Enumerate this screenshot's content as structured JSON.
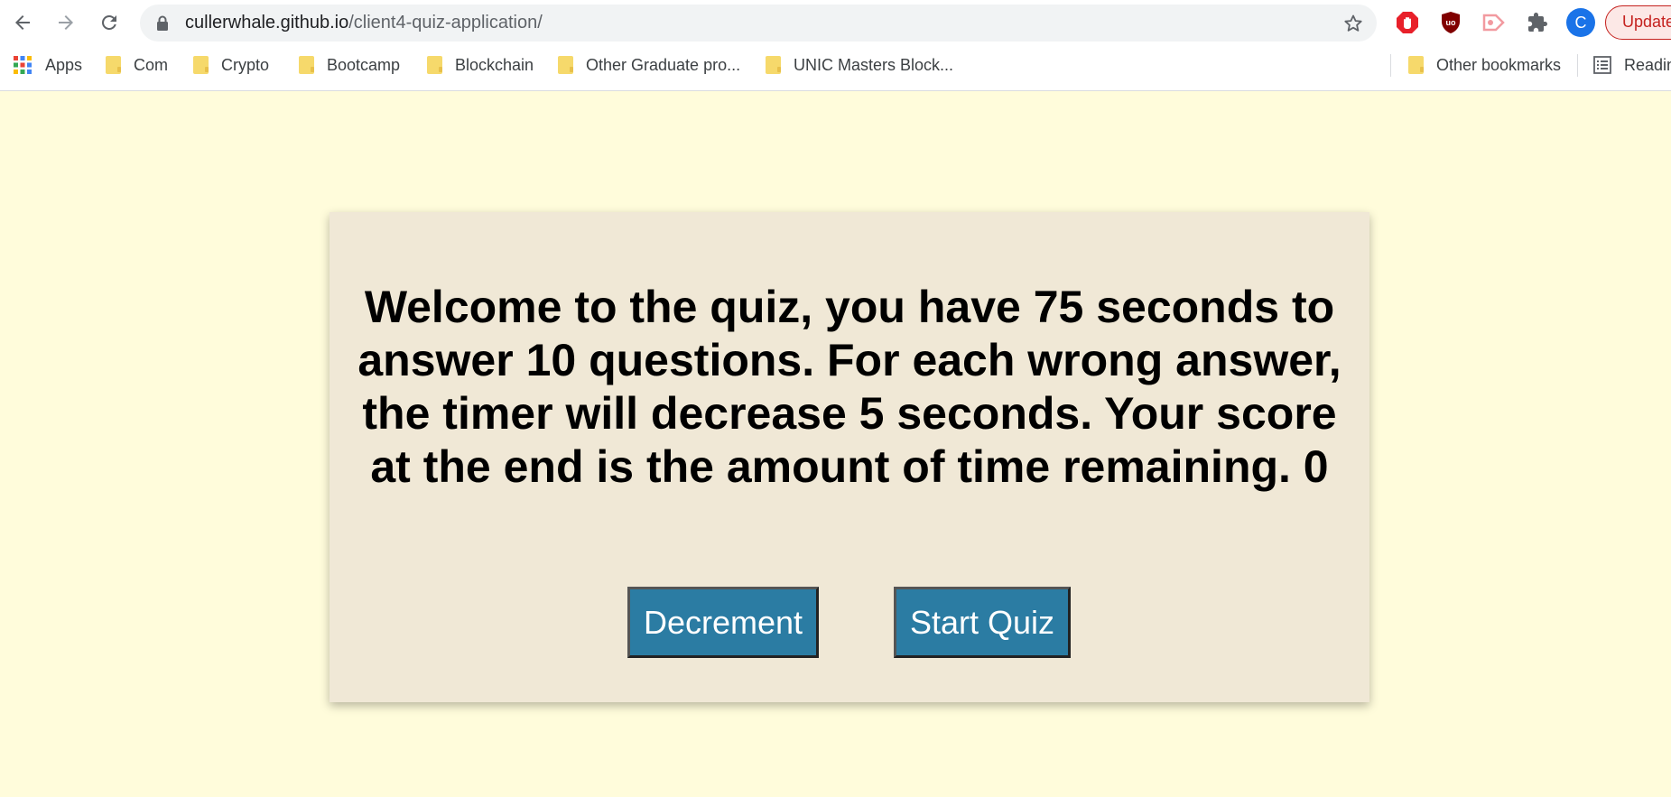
{
  "browser": {
    "url_host": "cullerwhale.github.io",
    "url_path": "/client4-quiz-application/",
    "profile_initial": "C",
    "update_label": "Update",
    "icons": {
      "back": "arrow-left-icon",
      "forward": "arrow-right-icon",
      "reload": "reload-icon",
      "lock": "lock-icon",
      "star": "star-icon",
      "extensions": [
        "adblock-icon",
        "ublock-icon",
        "screencast-icon",
        "puzzle-icon"
      ]
    }
  },
  "bookmarks": {
    "apps_label": "Apps",
    "items": [
      "Com",
      "Crypto",
      "Bootcamp",
      "Blockchain",
      "Other Graduate pro...",
      "UNIC Masters Block..."
    ],
    "other_label": "Other bookmarks",
    "reading_label": "Readin"
  },
  "quiz": {
    "welcome_text": "Welcome to the quiz, you have 75 seconds to answer 10 questions. For each wrong answer, the timer will decrease 5 seconds. Your score at the end is the amount of time remaining. 0",
    "decrement_label": "Decrement",
    "start_label": "Start Quiz"
  },
  "colors": {
    "page_bg": "#fffcdb",
    "card_bg": "#f0e8d6",
    "button_bg": "#2b7ca3",
    "button_text": "#ffffff"
  }
}
